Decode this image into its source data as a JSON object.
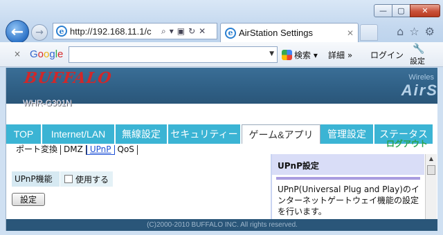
{
  "browser": {
    "address": "http://192.168.11.1/c",
    "tab_title": "AirStation Settings",
    "tab_close": "✕",
    "address_tools": [
      "⌕",
      "▾",
      "▣",
      "↻",
      "✕"
    ],
    "back_glyph": "←",
    "forward_glyph": "→",
    "window_buttons": {
      "minimize": "—",
      "maximize": "▢",
      "close": "✕"
    },
    "chrome_icons": [
      "⌂",
      "☆",
      "⚙"
    ]
  },
  "toolbar": {
    "close_glyph": "×",
    "google_letters": [
      {
        "ch": "G",
        "color": "#3366cc"
      },
      {
        "ch": "o",
        "color": "#d62b2b"
      },
      {
        "ch": "o",
        "color": "#eeb211"
      },
      {
        "ch": "g",
        "color": "#3366cc"
      },
      {
        "ch": "l",
        "color": "#28a745"
      },
      {
        "ch": "e",
        "color": "#d62b2b"
      }
    ],
    "search_value": "",
    "search_button": "検索",
    "details": "詳細 »",
    "login": "ログイン",
    "settings": "設定"
  },
  "router": {
    "brand": "BUFFALO",
    "wireless": "Wireles",
    "product": "AirS",
    "model": "WHR-G301N",
    "menu": [
      {
        "label": "TOP",
        "width": 52,
        "active": false
      },
      {
        "label": "Internet/LAN",
        "width": 106,
        "active": false
      },
      {
        "label": "無線設定",
        "width": 76,
        "active": false
      },
      {
        "label": "セキュリティー",
        "width": 106,
        "active": false
      },
      {
        "label": "ゲーム&アプリ",
        "width": 114,
        "active": true
      },
      {
        "label": "管理設定",
        "width": 78,
        "active": false
      },
      {
        "label": "ステータス",
        "width": 86,
        "active": false
      }
    ],
    "logout": "ログアウト",
    "submenu": [
      {
        "label": "ポート変換",
        "active": false
      },
      {
        "label": "DMZ",
        "active": false
      },
      {
        "label": "UPnP",
        "active": true
      },
      {
        "label": "QoS",
        "active": false
      }
    ],
    "upnp_label": "UPnP機能",
    "upnp_enable_label": "使用する",
    "upnp_enabled": false,
    "save_button": "設定",
    "help_title": "UPnP設定",
    "help_text": "UPnP(Universal Plug and Play)のインターネットゲートウェイ機能の設定を行います。",
    "footer": "(C)2000-2010 BUFFALO INC. All rights reserved."
  }
}
